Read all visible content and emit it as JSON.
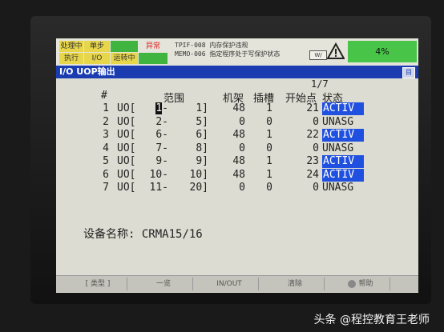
{
  "status": {
    "buttons": [
      {
        "label": "处理中"
      },
      {
        "label": "单步"
      },
      {
        "label": ""
      },
      {
        "label": "异常"
      },
      {
        "label": "执行"
      },
      {
        "label": "I/O"
      },
      {
        "label": "运转中"
      },
      {
        "label": ""
      }
    ],
    "alarm_line1": "TPIF-008 内存保护违规",
    "alarm_line2": "MEMO-006 指定程序处于写保护状态",
    "box_label": "W/",
    "override": "4%"
  },
  "title": "I/O UOP输出",
  "title_icon": "目",
  "table": {
    "page": "1/7",
    "headers": {
      "num": "#",
      "range": "范围",
      "rack": "机架",
      "slot": "插槽",
      "start": "开始点",
      "state": "状态"
    },
    "rows": [
      {
        "num": "1",
        "type": "UO[",
        "from": "1",
        "to": "1]",
        "rack": "48",
        "slot": "1",
        "start": "21",
        "state": "ACTIV"
      },
      {
        "num": "2",
        "type": "UO[",
        "from": "2",
        "to": "5]",
        "rack": "0",
        "slot": "0",
        "start": "0",
        "state": "UNASG"
      },
      {
        "num": "3",
        "type": "UO[",
        "from": "6",
        "to": "6]",
        "rack": "48",
        "slot": "1",
        "start": "22",
        "state": "ACTIV"
      },
      {
        "num": "4",
        "type": "UO[",
        "from": "7",
        "to": "8]",
        "rack": "0",
        "slot": "0",
        "start": "0",
        "state": "UNASG"
      },
      {
        "num": "5",
        "type": "UO[",
        "from": "9",
        "to": "9]",
        "rack": "48",
        "slot": "1",
        "start": "23",
        "state": "ACTIV"
      },
      {
        "num": "6",
        "type": "UO[",
        "from": "10",
        "to": "10]",
        "rack": "48",
        "slot": "1",
        "start": "24",
        "state": "ACTIV"
      },
      {
        "num": "7",
        "type": "UO[",
        "from": "11",
        "to": "20]",
        "rack": "0",
        "slot": "0",
        "start": "0",
        "state": "UNASG"
      }
    ]
  },
  "device": {
    "label": "设备名称:",
    "value": "CRMA15/16"
  },
  "softkeys": [
    {
      "label": "[ 类型 ]"
    },
    {
      "label": "一览"
    },
    {
      "label": "IN/OUT"
    },
    {
      "label": "清除"
    },
    {
      "label": "帮助"
    }
  ],
  "watermark": "头条 @程控教育王老师",
  "colors": {
    "title_bar": "#1a3cb0",
    "activ_bg": "#2050e0",
    "override_bg": "#48c448"
  }
}
